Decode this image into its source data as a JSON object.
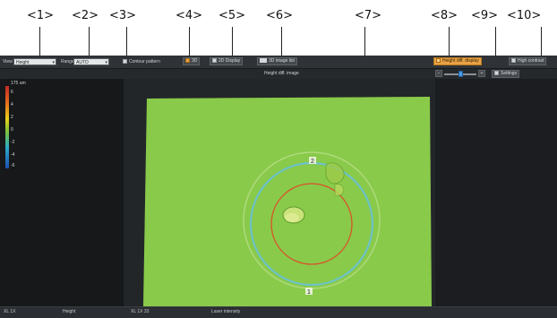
{
  "callouts": [
    "<1>",
    "<2>",
    "<3>",
    "<4>",
    "<5>",
    "<6>",
    "<7>",
    "<8>",
    "<9>",
    "<10>"
  ],
  "toolbar": {
    "view_label": "View",
    "view_value": "Height",
    "range_label": "Range",
    "range_value": "AUTO",
    "contour_label": "Contour pattern",
    "btn4_label": "3D",
    "btn5_label": "2D Display",
    "btn6_label": "3D image list",
    "btn8_label": "Height diff. display",
    "btn9_label": "Settings",
    "btn10_label": "High contrast"
  },
  "viewer": {
    "title": "Height diff. image",
    "marker_1": "1",
    "marker_2": "2"
  },
  "colorscale": {
    "unit": "175 um",
    "ticks": [
      "6",
      "4",
      "2",
      "0",
      "-2",
      "-4",
      "-6"
    ]
  },
  "statusbar": {
    "item1": "XL 1X",
    "item2": "Height",
    "item3": "XL 1X 33",
    "item4": "Laser intensity"
  },
  "colors": {
    "surface_green": "#7fc64a",
    "circle_outer": "#6cc2c8",
    "circle_inner": "#d9532a",
    "accent_orange": "#e8a246"
  }
}
